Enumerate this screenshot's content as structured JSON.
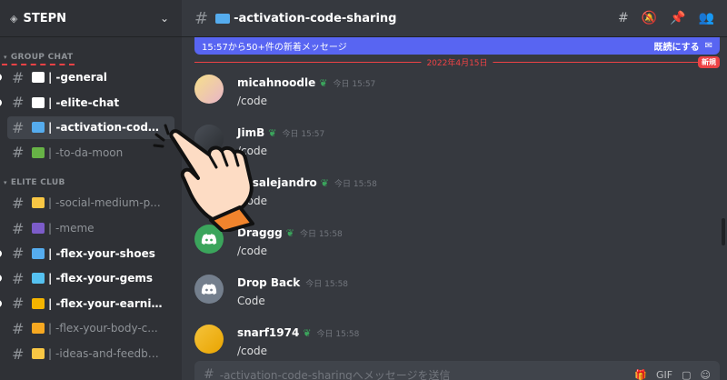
{
  "server": {
    "name": "STEPN"
  },
  "sidebar": {
    "categories": [
      {
        "title": "GROUP CHAT"
      },
      {
        "title": "ELITE CLUB"
      }
    ],
    "group_chat": [
      {
        "label": "-general",
        "emoji_color": "#ffffff",
        "state": "unread"
      },
      {
        "label": "-elite-chat",
        "emoji_color": "#ffffff",
        "state": "unread"
      },
      {
        "label": "-activation-code...",
        "emoji_color": "#55acee",
        "state": "active"
      },
      {
        "label": "-to-da-moon",
        "emoji_color": "#67b346",
        "state": "muted"
      }
    ],
    "elite_club": [
      {
        "label": "-social-medium-p...",
        "emoji_color": "#f9c744",
        "state": "muted"
      },
      {
        "label": "-meme",
        "emoji_color": "#7c5cc9",
        "state": "muted"
      },
      {
        "label": "-flex-your-shoes",
        "emoji_color": "#55acee",
        "state": "unread"
      },
      {
        "label": "-flex-your-gems",
        "emoji_color": "#55c1f0",
        "state": "unread"
      },
      {
        "label": "-flex-your-earning",
        "emoji_color": "#f4b400",
        "state": "unread"
      },
      {
        "label": "-flex-your-body-c...",
        "emoji_color": "#f6a821",
        "state": "muted"
      },
      {
        "label": "-ideas-and-feedba...",
        "emoji_color": "#f9c744",
        "state": "muted"
      }
    ]
  },
  "channel": {
    "name": "-activation-code-sharing"
  },
  "banner": {
    "text": "15:57から50+件の新着メッセージ",
    "action": "既読にする"
  },
  "divider": {
    "date": "2022年4月15日",
    "new_label": "新規"
  },
  "messages": [
    {
      "author": "micahnoodle",
      "time": "今日 15:57",
      "text": "/code",
      "avatar": "av-girl"
    },
    {
      "author": "JimB",
      "time": "今日 15:57",
      "text": "/code",
      "avatar": "av-dark"
    },
    {
      "author": "luisalejandro",
      "time": "今日 15:58",
      "text": "/code",
      "avatar": "av-dark"
    },
    {
      "author": "Draggg",
      "time": "今日 15:58",
      "text": "/code",
      "avatar": "av-discord-green"
    },
    {
      "author": "Drop Back",
      "time": "今日 15:58",
      "text": "Code",
      "avatar": "av-discord-gray"
    },
    {
      "author": "snarf1974",
      "time": "今日 15:58",
      "text": "/code",
      "avatar": "av-chick"
    }
  ],
  "composer": {
    "placeholder": "-activation-code-sharingへメッセージを送信"
  }
}
